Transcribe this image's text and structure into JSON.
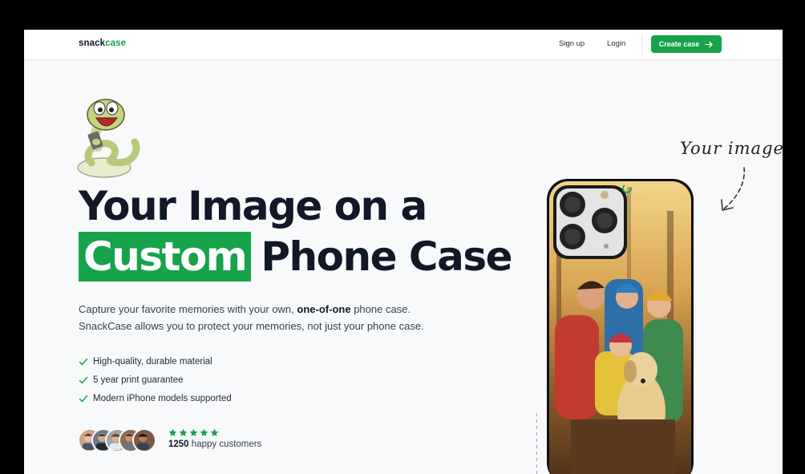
{
  "brand": {
    "part1": "snack",
    "part2": "case"
  },
  "nav": {
    "signup": "Sign up",
    "login": "Login",
    "cta": "Create case"
  },
  "hero": {
    "line1": "Your Image on a",
    "highlight": "Custom",
    "line2_rest": "Phone Case",
    "sub_part1": "Capture your favorite memories with your own,",
    "sub_bold": "one-of-one",
    "sub_part2": "phone case.",
    "sub_line2": "SnackCase allows you to protect your memories, not just your phone case.",
    "features": [
      "High-quality, durable material",
      "5 year print guarantee",
      "Modern iPhone models supported"
    ]
  },
  "social_proof": {
    "rating": 5,
    "count": "1250",
    "label": "happy customers"
  },
  "annotation": {
    "text": "Your image"
  },
  "colors": {
    "accent": "#16a34a",
    "text_dark": "#111827",
    "background": "#f8f9fb"
  }
}
